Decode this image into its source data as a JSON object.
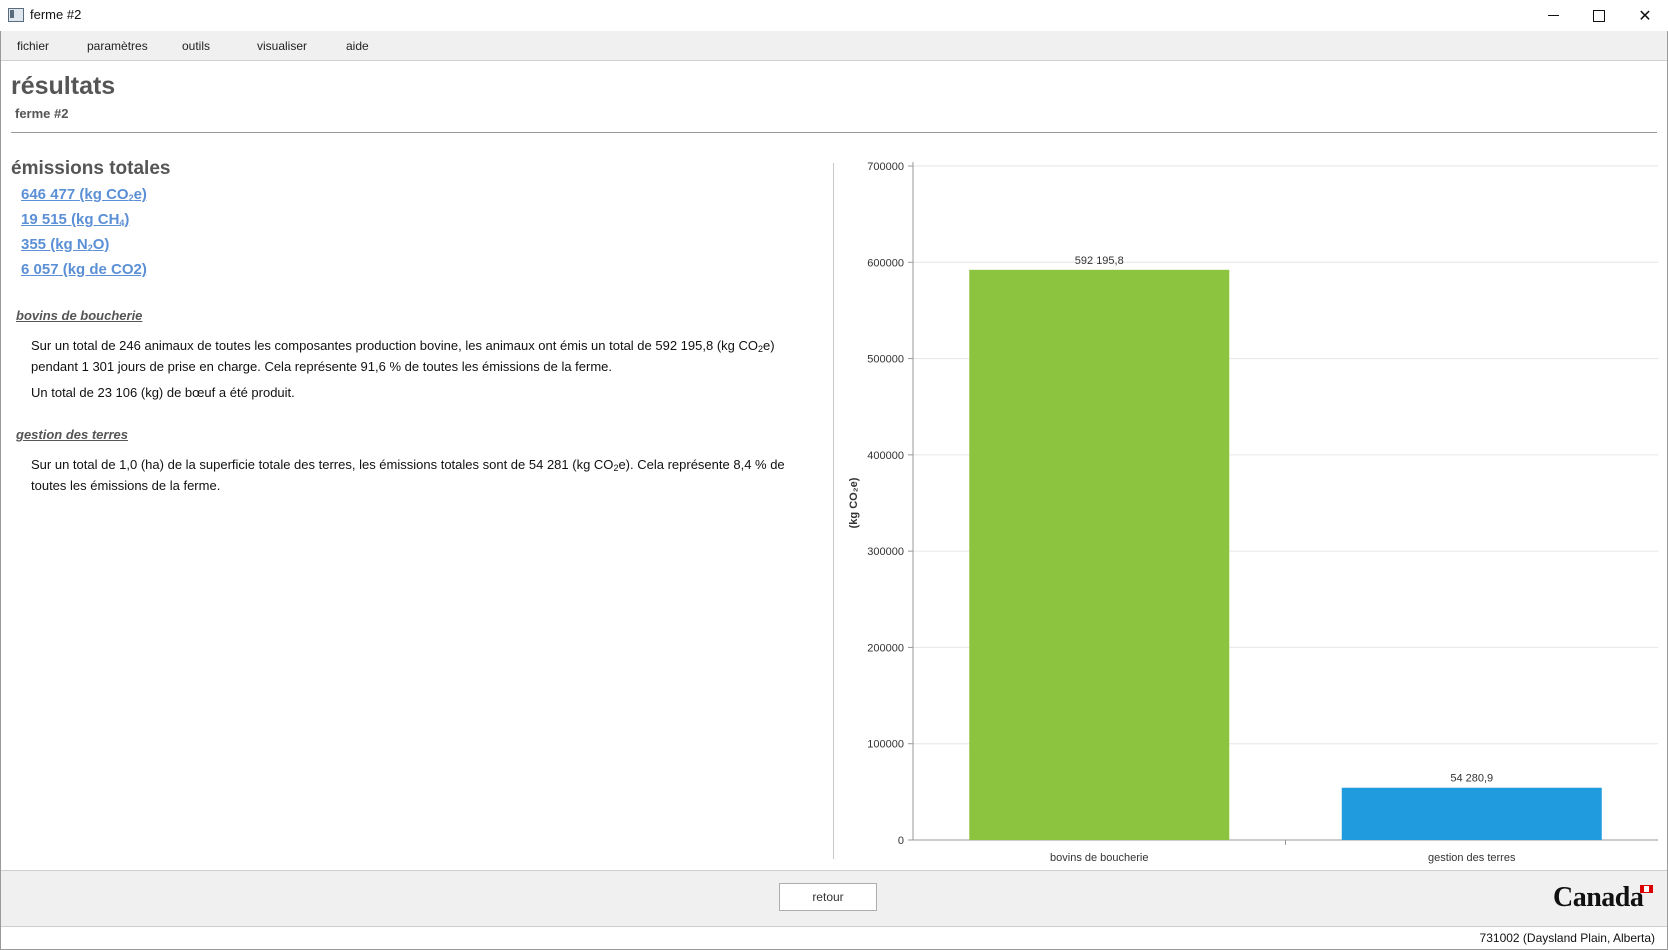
{
  "window": {
    "title": "ferme #2",
    "minimize": "",
    "maximize": "",
    "close": "✕"
  },
  "menu": [
    "fichier",
    "paramètres",
    "outils",
    "visualiser",
    "aide"
  ],
  "header": {
    "title": "résultats",
    "subtitle": "ferme #2"
  },
  "emissions": {
    "title": "émissions totales",
    "items": [
      {
        "value": "646 477",
        "unit_pre": "(kg CO",
        "unit_sub": "2",
        "unit_post": "e)"
      },
      {
        "value": "19 515",
        "unit_pre": "(kg CH",
        "unit_sub": "4",
        "unit_post": ")"
      },
      {
        "value": "355",
        "unit_pre": "(kg N",
        "unit_sub": "2",
        "unit_post": "O)"
      },
      {
        "value": "6 057",
        "unit_pre": "(kg de CO2)",
        "unit_sub": "",
        "unit_post": ""
      }
    ]
  },
  "sections": [
    {
      "heading": "bovins de boucherie",
      "p1_a": "Sur un total de 246 animaux de toutes les composantes production bovine, les animaux ont émis un total de 592 195,8 (kg CO",
      "p1_sub": "2",
      "p1_b": "e) pendant 1 301 jours de prise en charge. Cela représente 91,6 % de toutes les émissions de la ferme.",
      "p2": "Un total de 23 106 (kg) de bœuf a été produit."
    },
    {
      "heading": "gestion des terres",
      "p1_a": "Sur un total de 1,0 (ha) de la superficie totale des terres, les émissions totales sont de 54 281 (kg CO",
      "p1_sub": "2",
      "p1_b": "e). Cela représente 8,4 % de toutes les émissions de la ferme."
    }
  ],
  "chart_data": {
    "type": "bar",
    "categories": [
      "bovins de boucherie",
      "gestion des terres"
    ],
    "values": [
      592195.8,
      54280.9
    ],
    "value_labels": [
      "592 195,8",
      "54 280,9"
    ],
    "colors": [
      "#8dc43f",
      "#1f9bde"
    ],
    "ylabel": "(kg CO₂e)",
    "ylim": [
      0,
      700000
    ],
    "yticks": [
      0,
      100000,
      200000,
      300000,
      400000,
      500000,
      600000,
      700000
    ],
    "grid": true
  },
  "footer": {
    "back_label": "retour",
    "logo_text": "Canada"
  },
  "status": {
    "location": "731002 (Daysland Plain, Alberta)"
  }
}
